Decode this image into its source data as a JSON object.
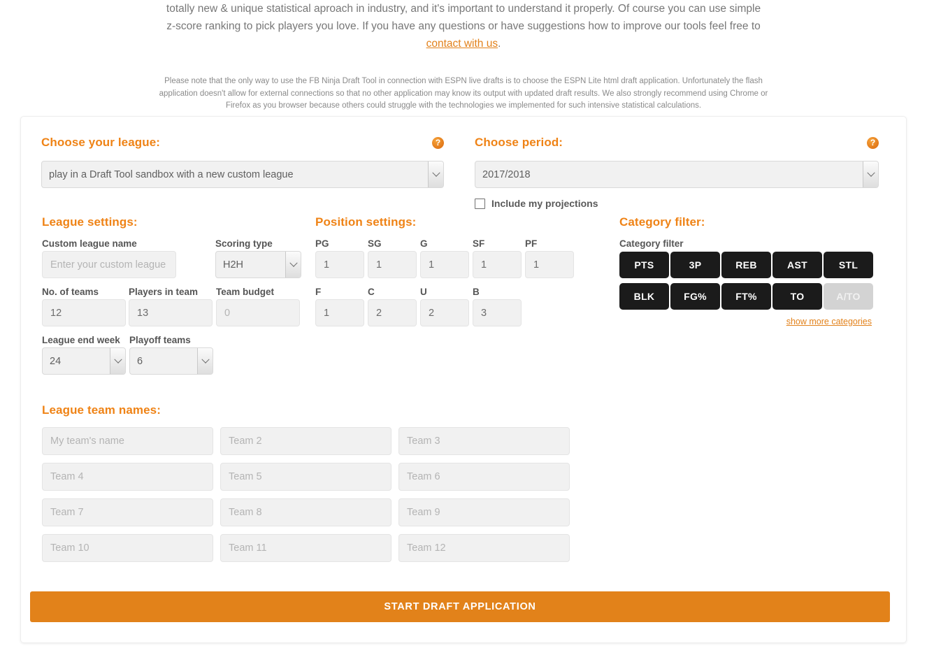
{
  "intro": {
    "line1": "totally new & unique statistical aproach in industry, and it's important to understand it properly. Of course you can use simple",
    "line2_before": "z-score ranking to pick players you love. If you have any questions or have suggestions how to improve our tools feel free to",
    "link_text": "contact with us",
    "line2_after": ".",
    "note": "Please note that the only way to use the FB Ninja Draft Tool in connection with ESPN live drafts is to choose the ESPN Lite html draft application. Unfortunately the flash application doesn't allow for external connections so that no other application may know its output with updated draft results. We also strongly recommend using Chrome or Firefox as you browser because others could struggle with the technologies we implemented for such intensive statistical calculations."
  },
  "league_choice": {
    "title": "Choose your league:",
    "help": "?",
    "selected": "play in a Draft Tool sandbox with a new custom league"
  },
  "period_choice": {
    "title": "Choose period:",
    "help": "?",
    "selected": "2017/2018",
    "checkbox_label": "Include my projections",
    "checkbox_checked": false
  },
  "league_settings": {
    "title": "League settings:",
    "custom_name": {
      "label": "Custom league name",
      "value": "",
      "placeholder": "Enter your custom league name"
    },
    "scoring_type": {
      "label": "Scoring type",
      "value": "H2H"
    },
    "no_of_teams": {
      "label": "No. of teams",
      "value": "12"
    },
    "players_in_team": {
      "label": "Players in team",
      "value": "13"
    },
    "team_budget": {
      "label": "Team budget",
      "value": "",
      "placeholder": "0"
    },
    "league_end_week": {
      "label": "League end week",
      "value": "24"
    },
    "playoff_teams": {
      "label": "Playoff teams",
      "value": "6"
    }
  },
  "position_settings": {
    "title": "Position settings:",
    "row1": [
      {
        "label": "PG",
        "value": "1"
      },
      {
        "label": "SG",
        "value": "1"
      },
      {
        "label": "G",
        "value": "1"
      },
      {
        "label": "SF",
        "value": "1"
      },
      {
        "label": "PF",
        "value": "1"
      }
    ],
    "row2": [
      {
        "label": "F",
        "value": "1"
      },
      {
        "label": "C",
        "value": "2"
      },
      {
        "label": "U",
        "value": "2"
      },
      {
        "label": "B",
        "value": "3"
      }
    ]
  },
  "category_filter": {
    "title": "Category filter:",
    "sublabel": "Category filter",
    "row1": [
      {
        "label": "PTS",
        "active": true
      },
      {
        "label": "3P",
        "active": true
      },
      {
        "label": "REB",
        "active": true
      },
      {
        "label": "AST",
        "active": true
      },
      {
        "label": "STL",
        "active": true
      }
    ],
    "row2": [
      {
        "label": "BLK",
        "active": true
      },
      {
        "label": "FG%",
        "active": true
      },
      {
        "label": "FT%",
        "active": true
      },
      {
        "label": "TO",
        "active": true
      },
      {
        "label": "A/TO",
        "active": false
      }
    ],
    "show_more": "show more categories"
  },
  "team_names": {
    "title": "League team names:",
    "teams": [
      {
        "placeholder": "My team's name"
      },
      {
        "placeholder": "Team 2"
      },
      {
        "placeholder": "Team 3"
      },
      {
        "placeholder": "Team 4"
      },
      {
        "placeholder": "Team 5"
      },
      {
        "placeholder": "Team 6"
      },
      {
        "placeholder": "Team 7"
      },
      {
        "placeholder": "Team 8"
      },
      {
        "placeholder": "Team 9"
      },
      {
        "placeholder": "Team 10"
      },
      {
        "placeholder": "Team 11"
      },
      {
        "placeholder": "Team 12"
      }
    ]
  },
  "start_button": {
    "label": "START DRAFT APPLICATION"
  },
  "colors": {
    "accent": "#ef8316",
    "cta": "#e2821a",
    "category_on": "#1b1b1b",
    "category_off": "#d3d3d3"
  }
}
